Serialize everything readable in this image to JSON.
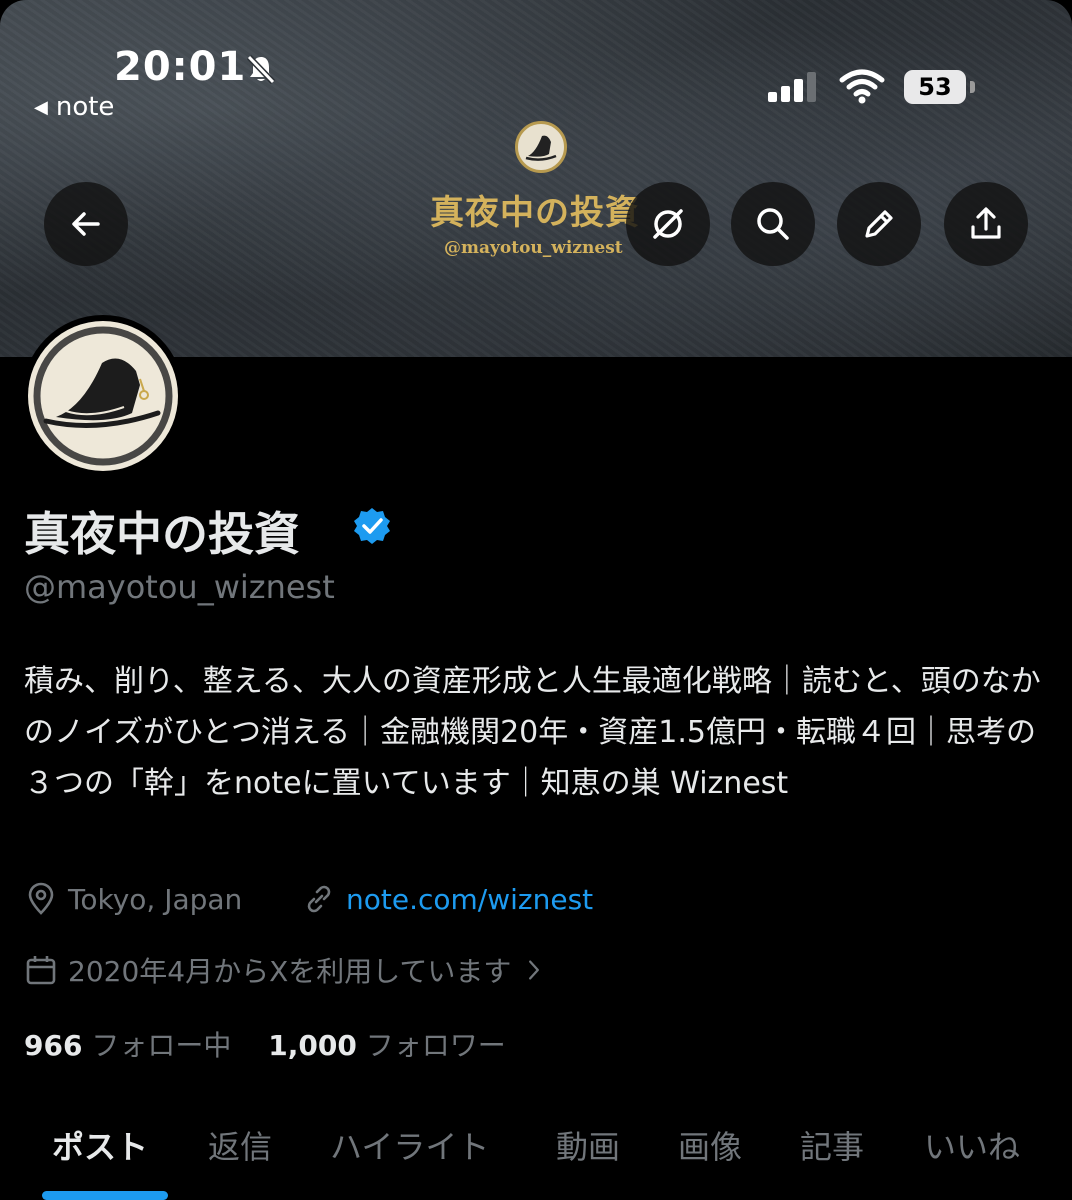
{
  "status_bar": {
    "time": "20:01",
    "back_app": "note",
    "battery": "53"
  },
  "banner": {
    "title": "真夜中の投資",
    "handle": "@mayotou_wiznest"
  },
  "profile": {
    "display_name": "真夜中の投資",
    "handle": "@mayotou_wiznest",
    "bio": "積み、削り、整える、大人の資産形成と人生最適化戦略｜読むと、頭のなかのノイズがひとつ消える｜金融機関20年・資産1.5億円・転職４回｜思考の３つの「幹」をnoteに置いています｜知恵の巣 Wiznest",
    "location": "Tokyo, Japan",
    "website": "note.com/wiznest",
    "joined": "2020年4月からXを利用しています",
    "following_count": "966",
    "following_label": "フォロー中",
    "followers_count": "1,000",
    "followers_label": "フォロワー"
  },
  "tabs": [
    "ポスト",
    "返信",
    "ハイライト",
    "動画",
    "画像",
    "記事",
    "いいね"
  ],
  "colors": {
    "accent": "#1d9bf0",
    "muted": "#71767b",
    "text": "#e7e9ea",
    "gold": "#d4b25c"
  }
}
